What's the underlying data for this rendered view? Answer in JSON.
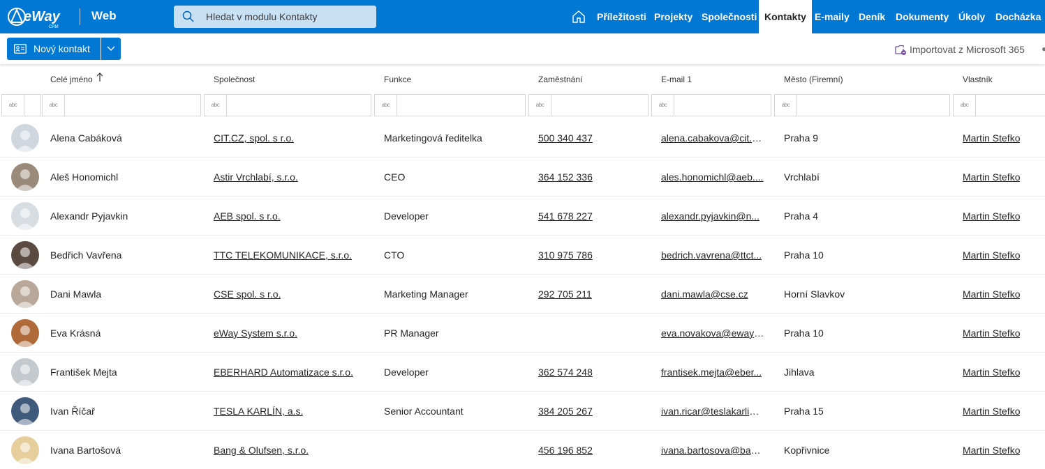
{
  "header": {
    "logo_text": "eWay",
    "logo_sub": "CRM",
    "app_name": "Web",
    "search_placeholder": "Hledat v modulu Kontakty",
    "nav": [
      {
        "label": "Příležitosti",
        "active": false
      },
      {
        "label": "Projekty",
        "active": false
      },
      {
        "label": "Společnosti",
        "active": false
      },
      {
        "label": "Kontakty",
        "active": true
      },
      {
        "label": "E-maily",
        "active": false
      },
      {
        "label": "Deník",
        "active": false
      },
      {
        "label": "Dokumenty",
        "active": false
      },
      {
        "label": "Úkoly",
        "active": false
      },
      {
        "label": "Docházka",
        "active": false
      }
    ],
    "accent_color": "#0078d4"
  },
  "toolbar": {
    "new_contact_label": "Nový kontakt",
    "import_label": "Importovat z Microsoft 365"
  },
  "grid": {
    "columns": [
      {
        "key": "name",
        "label": "Celé jméno",
        "sorted": "asc"
      },
      {
        "key": "company",
        "label": "Společnost"
      },
      {
        "key": "function",
        "label": "Funkce"
      },
      {
        "key": "phone",
        "label": "Zaměstnání"
      },
      {
        "key": "email",
        "label": "E-mail 1"
      },
      {
        "key": "city",
        "label": "Město (Firemní)"
      },
      {
        "key": "owner",
        "label": "Vlastník"
      }
    ],
    "filter_type_label": "abc",
    "rows": [
      {
        "name": "Alena Cabáková",
        "company": "CIT.CZ, spol. s r.o.",
        "function": "Marketingová ředitelka",
        "phone": "500 340 437",
        "email": "alena.cabakova@cit.c...",
        "city": "Praha 9",
        "owner": "Martin Stefko",
        "avatar_color": "#cfd6de"
      },
      {
        "name": "Aleš Honomichl",
        "company": "Astir Vrchlabí, s.r.o.",
        "function": "CEO",
        "phone": "364 152 336",
        "email": "ales.honomichl@aeb....",
        "city": "Vrchlabí",
        "owner": "Martin Stefko",
        "avatar_color": "#9a8a7a"
      },
      {
        "name": "Alexandr Pyjavkin",
        "company": "AEB spol. s r.o.",
        "function": "Developer",
        "phone": "541 678 227",
        "email": "alexandr.pyjavkin@n...",
        "city": "Praha 4",
        "owner": "Martin Stefko",
        "avatar_color": "#d8dde2"
      },
      {
        "name": "Bedřich Vavřena",
        "company": "TTC TELEKOMUNIKACE, s.r.o.",
        "function": "CTO",
        "phone": "310 975 786",
        "email": "bedrich.vavrena@ttct...",
        "city": "Praha 10",
        "owner": "Martin Stefko",
        "avatar_color": "#5a4a40"
      },
      {
        "name": "Dani Mawla",
        "company": "CSE spol. s r.o.",
        "function": "Marketing Manager",
        "phone": "292 705 211",
        "email": "dani.mawla@cse.cz",
        "city": "Horní Slavkov",
        "owner": "Martin Stefko",
        "avatar_color": "#b9a89a"
      },
      {
        "name": "Eva Krásná",
        "company": "eWay System s.r.o.",
        "function": "PR Manager",
        "phone": "",
        "email": "eva.novakova@eway-...",
        "city": "Praha 10",
        "owner": "Martin Stefko",
        "avatar_color": "#b06a3a"
      },
      {
        "name": "František Mejta",
        "company": "EBERHARD Automatizace s.r.o.",
        "function": "Developer",
        "phone": "362 574 248",
        "email": "frantisek.mejta@eber...",
        "city": "Jihlava",
        "owner": "Martin Stefko",
        "avatar_color": "#c4c9ce"
      },
      {
        "name": "Ivan Říčař",
        "company": "TESLA KARLÍN, a.s.",
        "function": "Senior Accountant",
        "phone": "384 205 267",
        "email": "ivan.ricar@teslakarlin....",
        "city": "Praha 15",
        "owner": "Martin Stefko",
        "avatar_color": "#3f5a7a"
      },
      {
        "name": "Ivana Bartošová",
        "company": "Bang & Olufsen, s.r.o.",
        "function": "",
        "phone": "456 196 852",
        "email": "ivana.bartosova@ban...",
        "city": "Kopřivnice",
        "owner": "Martin Stefko",
        "avatar_color": "#e6cf9c"
      }
    ]
  }
}
